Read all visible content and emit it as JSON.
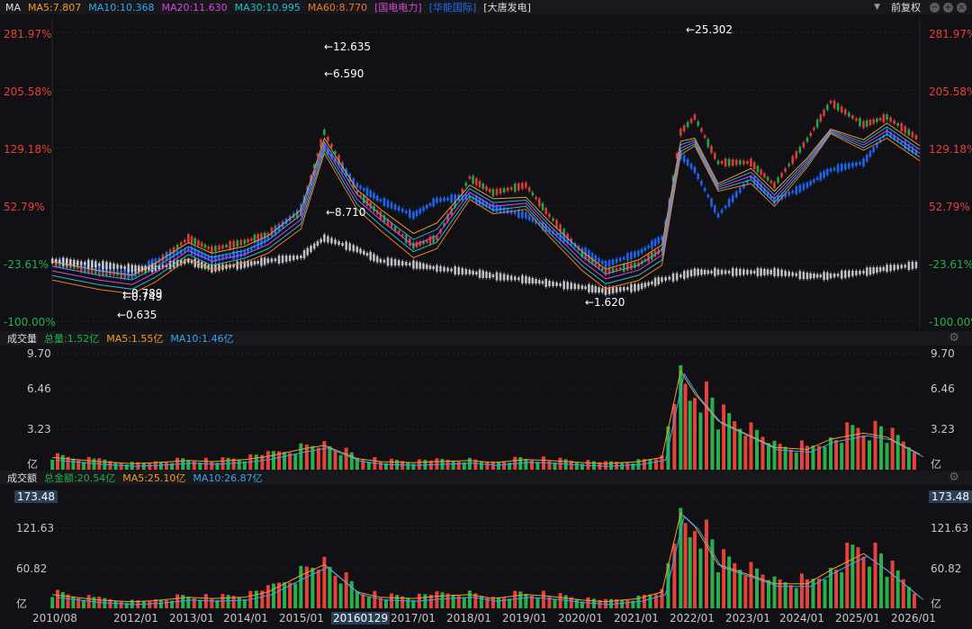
{
  "header": {
    "indicator": "MA",
    "ma5": "MA5:7.807",
    "ma10": "MA10:10.368",
    "ma20": "MA20:11.630",
    "ma30": "MA30:10.995",
    "ma60": "MA60:8.770",
    "compare1": "[国电电力]",
    "compare2": "[华能国际]",
    "compare3": "[大唐发电]",
    "adjust": "前复权"
  },
  "colors": {
    "up": "#e8413a",
    "down": "#1f6bff",
    "green": "#26b14a",
    "white": "#dcdcdc",
    "ma5": "#f39c27",
    "ma10": "#37a8f0",
    "ma20": "#d848d8",
    "ma30": "#20c0c8",
    "ma60": "#f07a28"
  },
  "price_axis": {
    "left_ticks": [
      "281.97%",
      "205.58%",
      "129.18%",
      "52.79%",
      "-23.61%",
      "-100.00%"
    ],
    "right_ticks": [
      "281.97%",
      "205.58%",
      "129.18%",
      "52.79%",
      "-23.61%",
      "-100.00%"
    ]
  },
  "price_labels": [
    "←12.635",
    "←6.590",
    "←8.710",
    "←0.789",
    "←0.749",
    "←0.635",
    "←1.620",
    "←25.302"
  ],
  "volume_panel": {
    "title": "成交量",
    "total": "总量:1.52亿",
    "ma5": "MA5:1.55亿",
    "ma10": "MA10:1.46亿",
    "ticks": [
      "9.70",
      "6.46",
      "3.23",
      "亿"
    ]
  },
  "amount_panel": {
    "title": "成交额",
    "total": "总金额:20.54亿",
    "ma5": "MA5:25.10亿",
    "ma10": "MA10:26.87亿",
    "ticks": [
      "173.48",
      "121.63",
      "60.82",
      "亿"
    ]
  },
  "x_axis": [
    "2010/08",
    "2012/01",
    "2013/01",
    "2014/01",
    "2015/01",
    "20160129",
    "2017/01",
    "2018/01",
    "2019/01",
    "2020/01",
    "2021/01",
    "2022/01",
    "2023/01",
    "2024/01",
    "2025/01",
    "2026/01"
  ],
  "chart_data": {
    "type": "line",
    "x_range": [
      "2010/08",
      "2026/01"
    ],
    "series": [
      {
        "name": "国电电力",
        "dates": [
          "2010/08",
          "2011/06",
          "2012/01",
          "2012/06",
          "2013/01",
          "2013/06",
          "2014/01",
          "2014/06",
          "2015/01",
          "2015/06",
          "2016/01",
          "2016/06",
          "2017/01",
          "2017/06",
          "2018/01",
          "2018/06",
          "2019/01",
          "2019/06",
          "2020/01",
          "2020/06",
          "2021/01",
          "2021/06",
          "2021/10",
          "2022/01",
          "2022/06",
          "2023/01",
          "2023/06",
          "2024/01",
          "2024/06",
          "2025/01",
          "2025/06",
          "2026/01"
        ],
        "values": [
          -22,
          -35,
          -40,
          -25,
          10,
          -5,
          5,
          15,
          45,
          150,
          70,
          40,
          0,
          10,
          90,
          70,
          80,
          40,
          -10,
          -35,
          -25,
          -5,
          150,
          170,
          110,
          110,
          80,
          140,
          190,
          160,
          170,
          140
        ]
      },
      {
        "name": "华能国际",
        "dates": [
          "2010/08",
          "2011/06",
          "2012/01",
          "2012/06",
          "2013/01",
          "2013/06",
          "2014/01",
          "2014/06",
          "2015/01",
          "2015/06",
          "2016/01",
          "2016/06",
          "2017/01",
          "2017/06",
          "2018/01",
          "2018/06",
          "2019/01",
          "2019/06",
          "2020/01",
          "2020/06",
          "2021/01",
          "2021/06",
          "2021/10",
          "2022/01",
          "2022/06",
          "2023/01",
          "2023/06",
          "2024/01",
          "2024/06",
          "2025/01",
          "2025/06",
          "2026/01"
        ],
        "values": [
          -20,
          -30,
          -38,
          -20,
          -5,
          -18,
          -10,
          10,
          50,
          130,
          80,
          60,
          40,
          60,
          65,
          50,
          40,
          20,
          -5,
          -25,
          -10,
          10,
          120,
          100,
          40,
          90,
          60,
          80,
          100,
          110,
          150,
          120
        ]
      },
      {
        "name": "大唐发电",
        "dates": [
          "2010/08",
          "2011/06",
          "2012/01",
          "2012/06",
          "2013/01",
          "2013/06",
          "2014/01",
          "2014/06",
          "2015/01",
          "2015/06",
          "2016/01",
          "2016/06",
          "2017/01",
          "2017/06",
          "2018/01",
          "2018/06",
          "2019/01",
          "2019/06",
          "2020/01",
          "2020/06",
          "2021/01",
          "2021/06",
          "2021/10",
          "2022/01",
          "2022/06",
          "2023/01",
          "2023/06",
          "2024/01",
          "2024/06",
          "2025/01",
          "2025/06",
          "2026/01"
        ],
        "values": [
          -20,
          -25,
          -30,
          -30,
          -20,
          -30,
          -25,
          -20,
          -15,
          10,
          -5,
          -20,
          -25,
          -30,
          -35,
          -40,
          -45,
          -50,
          -55,
          -60,
          -55,
          -45,
          -40,
          -35,
          -35,
          -35,
          -35,
          -40,
          -40,
          -35,
          -30,
          -25
        ]
      }
    ],
    "yticks": [
      "281.97%",
      "205.58%",
      "129.18%",
      "52.79%",
      "-23.61%",
      "-100.00%"
    ],
    "ylim": [
      -100,
      281.97
    ],
    "volume": {
      "unit": "亿",
      "ylim": [
        0,
        9.7
      ],
      "dates": [
        "2010/08",
        "2011/06",
        "2012/01",
        "2012/06",
        "2013/01",
        "2013/06",
        "2014/01",
        "2014/06",
        "2015/01",
        "2015/06",
        "2016/01",
        "2016/06",
        "2017/01",
        "2017/06",
        "2018/01",
        "2018/06",
        "2019/01",
        "2019/06",
        "2020/01",
        "2020/06",
        "2021/01",
        "2021/06",
        "2021/10",
        "2022/01",
        "2022/06",
        "2023/01",
        "2023/06",
        "2024/01",
        "2024/06",
        "2025/01",
        "2025/06",
        "2026/01"
      ],
      "values": [
        1.2,
        0.8,
        0.6,
        0.7,
        0.9,
        0.8,
        1.0,
        1.3,
        2.0,
        2.4,
        1.1,
        0.8,
        0.7,
        0.8,
        0.9,
        0.7,
        1.0,
        0.9,
        0.7,
        0.6,
        0.8,
        1.2,
        9.7,
        7.5,
        4.8,
        3.3,
        2.2,
        2.0,
        3.0,
        3.6,
        3.2,
        1.52
      ]
    },
    "amount": {
      "unit": "亿",
      "ylim": [
        0,
        173.48
      ],
      "dates": [
        "2010/08",
        "2011/06",
        "2012/01",
        "2012/06",
        "2013/01",
        "2013/06",
        "2014/01",
        "2014/06",
        "2015/01",
        "2015/06",
        "2016/01",
        "2016/06",
        "2017/01",
        "2017/06",
        "2018/01",
        "2018/06",
        "2019/01",
        "2019/06",
        "2020/01",
        "2020/06",
        "2021/01",
        "2021/06",
        "2021/10",
        "2022/01",
        "2022/06",
        "2023/01",
        "2023/06",
        "2024/01",
        "2024/06",
        "2025/01",
        "2025/06",
        "2026/01"
      ],
      "values": [
        25,
        15,
        12,
        14,
        20,
        18,
        20,
        30,
        60,
        80,
        30,
        20,
        18,
        22,
        25,
        18,
        25,
        22,
        15,
        12,
        18,
        30,
        173.48,
        150,
        80,
        60,
        45,
        45,
        70,
        100,
        70,
        20.54
      ]
    }
  }
}
